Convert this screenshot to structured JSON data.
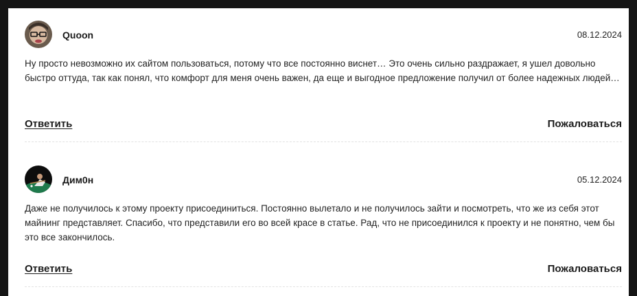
{
  "comments": [
    {
      "author": "Quoon",
      "date": "08.12.2024",
      "text": "Ну просто невозможно их сайтом пользоваться, потому что все постоянно виснет… Это очень сильно раздражает, я ушел довольно быстро оттуда, так как понял, что комфорт для меня очень важен, да еще и выгодное предложение получил от более надежных людей…",
      "reply_label": "Ответить",
      "report_label": "Пожаловаться",
      "avatar_icon": "user-photo-avatar"
    },
    {
      "author": "Дим0н",
      "date": "05.12.2024",
      "text": "Даже не получилось к этому проекту присоединиться. Постоянно вылетало и не получилось зайти и посмотреть, что же из себя этот майнинг представляет. Спасибо, что представили его во всей красе в статье. Рад, что не присоединился к проекту и не понятно, чем бы это все закончилось.",
      "reply_label": "Ответить",
      "report_label": "Пожаловаться",
      "avatar_icon": "user-photo-avatar"
    }
  ],
  "colors": {
    "page_background": "#151515",
    "panel_background": "#ffffff",
    "text": "#1a1a1a",
    "divider": "#e2e2e2"
  }
}
